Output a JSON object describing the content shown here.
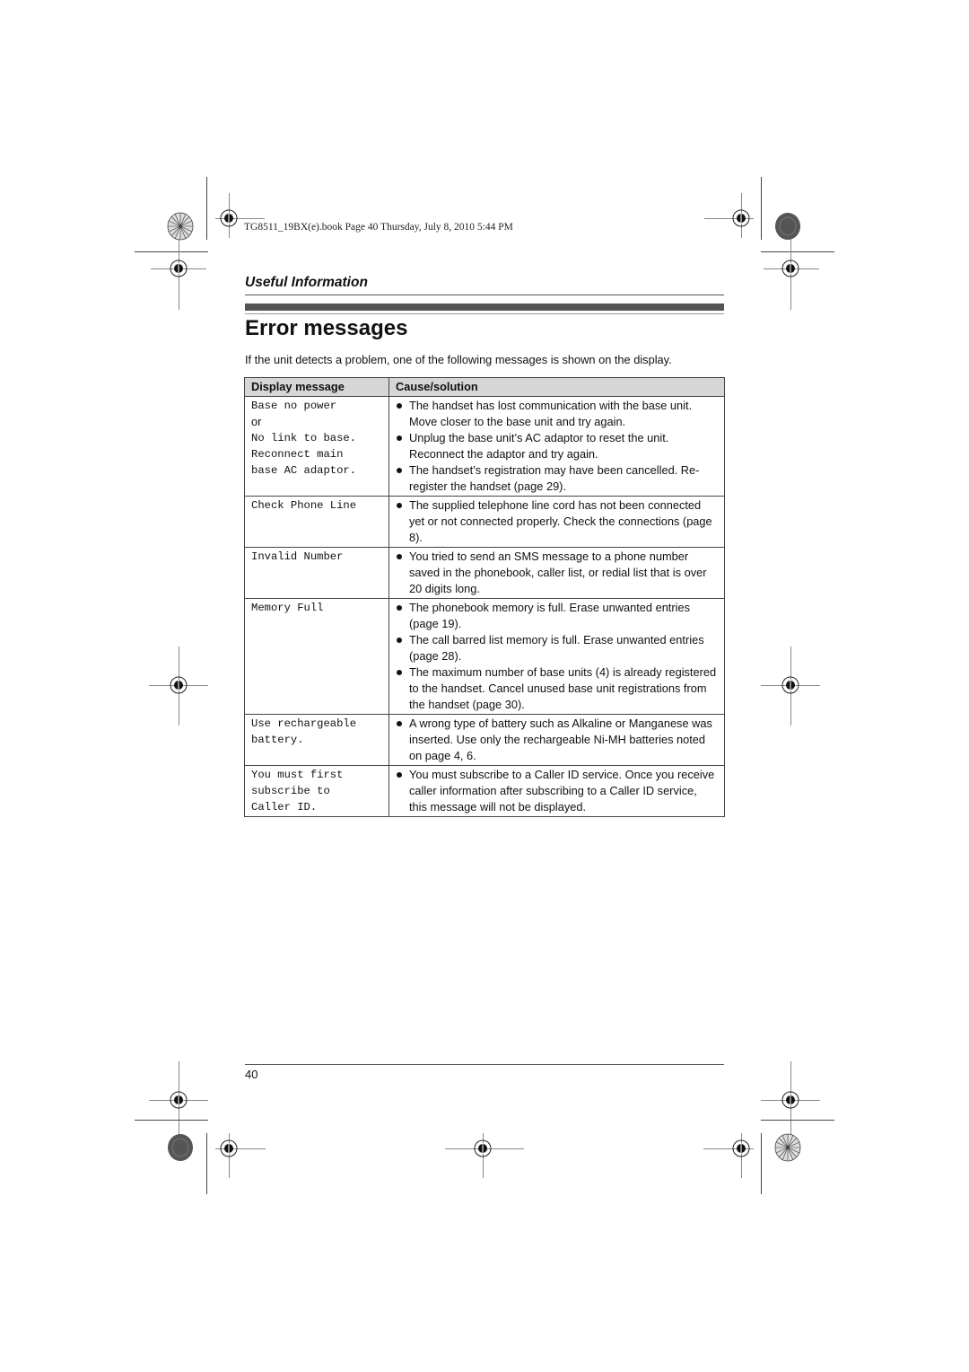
{
  "print_header": "TG8511_19BX(e).book  Page 40  Thursday, July 8, 2010  5:44 PM",
  "section": "Useful Information",
  "title": "Error messages",
  "intro": "If the unit detects a problem, one of the following messages is shown on the display.",
  "table": {
    "headers": [
      "Display message",
      "Cause/solution"
    ],
    "rows": [
      {
        "message_lines": [
          "Base no power",
          "or",
          "No link to base.",
          "Reconnect main",
          "base AC adaptor."
        ],
        "causes": [
          "The handset has lost communication with the base unit. Move closer to the base unit and try again.",
          "Unplug the base unit’s AC adaptor to reset the unit. Reconnect the adaptor and try again.",
          "The handset’s registration may have been cancelled. Re-register the handset (page 29)."
        ]
      },
      {
        "message_lines": [
          "Check Phone Line"
        ],
        "causes": [
          "The supplied telephone line cord has not been connected yet or not connected properly. Check the connections (page 8)."
        ]
      },
      {
        "message_lines": [
          "Invalid Number"
        ],
        "causes": [
          "You tried to send an SMS message to a phone number saved in the phonebook, caller list, or redial list that is over 20 digits long."
        ]
      },
      {
        "message_lines": [
          "Memory Full"
        ],
        "causes": [
          "The phonebook memory is full. Erase unwanted entries (page 19).",
          "The call barred list memory is full. Erase unwanted entries (page 28).",
          "The maximum number of base units (4) is already registered to the handset. Cancel unused base unit registrations from the handset (page 30)."
        ]
      },
      {
        "message_lines": [
          "Use rechargeable",
          "battery."
        ],
        "causes": [
          "A wrong type of battery such as Alkaline or Manganese was inserted. Use only the rechargeable Ni-MH batteries noted on page 4, 6."
        ]
      },
      {
        "message_lines": [
          "You must first",
          "subscribe to",
          "Caller ID."
        ],
        "causes": [
          "You must subscribe to a Caller ID service. Once you receive caller information after subscribing to a Caller ID service, this message will not be displayed."
        ]
      }
    ]
  },
  "page_number": "40",
  "icons": {
    "registration_mark": "crosshair-circle",
    "color_wheel": "starburst-circle",
    "gray_disc": "gray-dot-circle"
  }
}
